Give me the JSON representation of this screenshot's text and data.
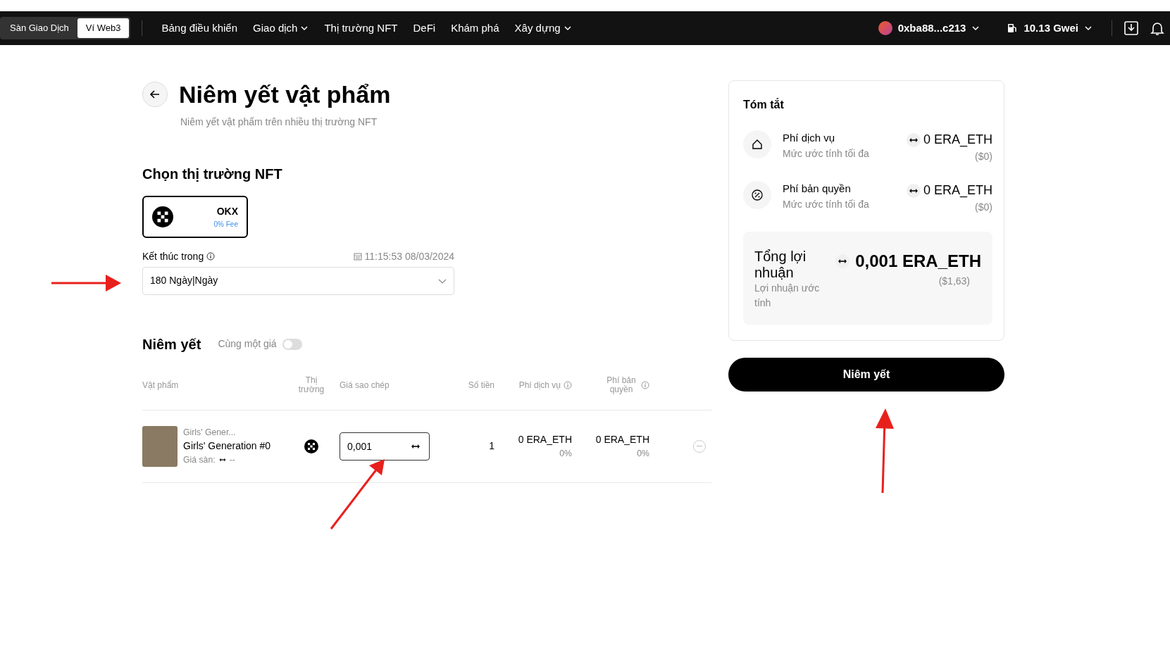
{
  "nav": {
    "tabs": [
      {
        "label": "Sàn Giao Dịch",
        "selected": false
      },
      {
        "label": "Ví Web3",
        "selected": true
      }
    ],
    "menu": [
      {
        "label": "Bảng điều khiển",
        "dropdown": false
      },
      {
        "label": "Giao dịch",
        "dropdown": true
      },
      {
        "label": "Thị trường NFT",
        "dropdown": false
      },
      {
        "label": "DeFi",
        "dropdown": false
      },
      {
        "label": "Khám phá",
        "dropdown": false
      },
      {
        "label": "Xây dựng",
        "dropdown": true
      }
    ],
    "account": "0xba88...c213",
    "gas": "10.13 Gwei"
  },
  "header": {
    "title": "Niêm yết vật phẩm",
    "subtitle": "Niêm yết vật phẩm trên nhiều thị trường NFT"
  },
  "marketplace": {
    "title": "Chọn thị trường NFT",
    "markets": [
      {
        "name": "OKX",
        "fee": "0% Fee",
        "selected": true
      }
    ],
    "end_label": "Kết thúc trong",
    "end_date": "11:15:53 08/03/2024",
    "duration": "180 Ngày|Ngày"
  },
  "listing": {
    "title": "Niêm yết",
    "same_price_label": "Cùng một giá",
    "same_price": false,
    "columns": [
      {
        "label": "Vật phẩm",
        "info": false
      },
      {
        "label": "Thị trường",
        "info": false
      },
      {
        "label": "Giá sao chép",
        "info": false
      },
      {
        "label": "Số tiền",
        "info": false
      },
      {
        "label": "Phí dịch vụ",
        "info": true
      },
      {
        "label": "Phí bản quyền",
        "info": true
      }
    ],
    "rows": [
      {
        "collection": "Girls' Gener...",
        "name": "Girls' Generation #0",
        "floor_label": "Giá sàn:",
        "floor": "--",
        "price": "0,001",
        "amount": "1",
        "service_fee": "0 ERA_ETH",
        "service_pct": "0%",
        "royalty": "0 ERA_ETH",
        "royalty_pct": "0%"
      }
    ]
  },
  "summary": {
    "title": "Tóm tắt",
    "fees": [
      {
        "kind": "service",
        "label": "Phí dịch vụ",
        "note": "Mức ước tính tối đa",
        "value": "0 ERA_ETH",
        "usd": "($0)"
      },
      {
        "kind": "royalty",
        "label": "Phí bản quyền",
        "note": "Mức ước tính tối đa",
        "value": "0 ERA_ETH",
        "usd": "($0)"
      }
    ],
    "total": {
      "label": "Tổng lợi nhuận",
      "note": "Lợi nhuận ước tính",
      "value": "0,001 ERA_ETH",
      "usd": "($1,63)"
    },
    "button": "Niêm yết"
  }
}
